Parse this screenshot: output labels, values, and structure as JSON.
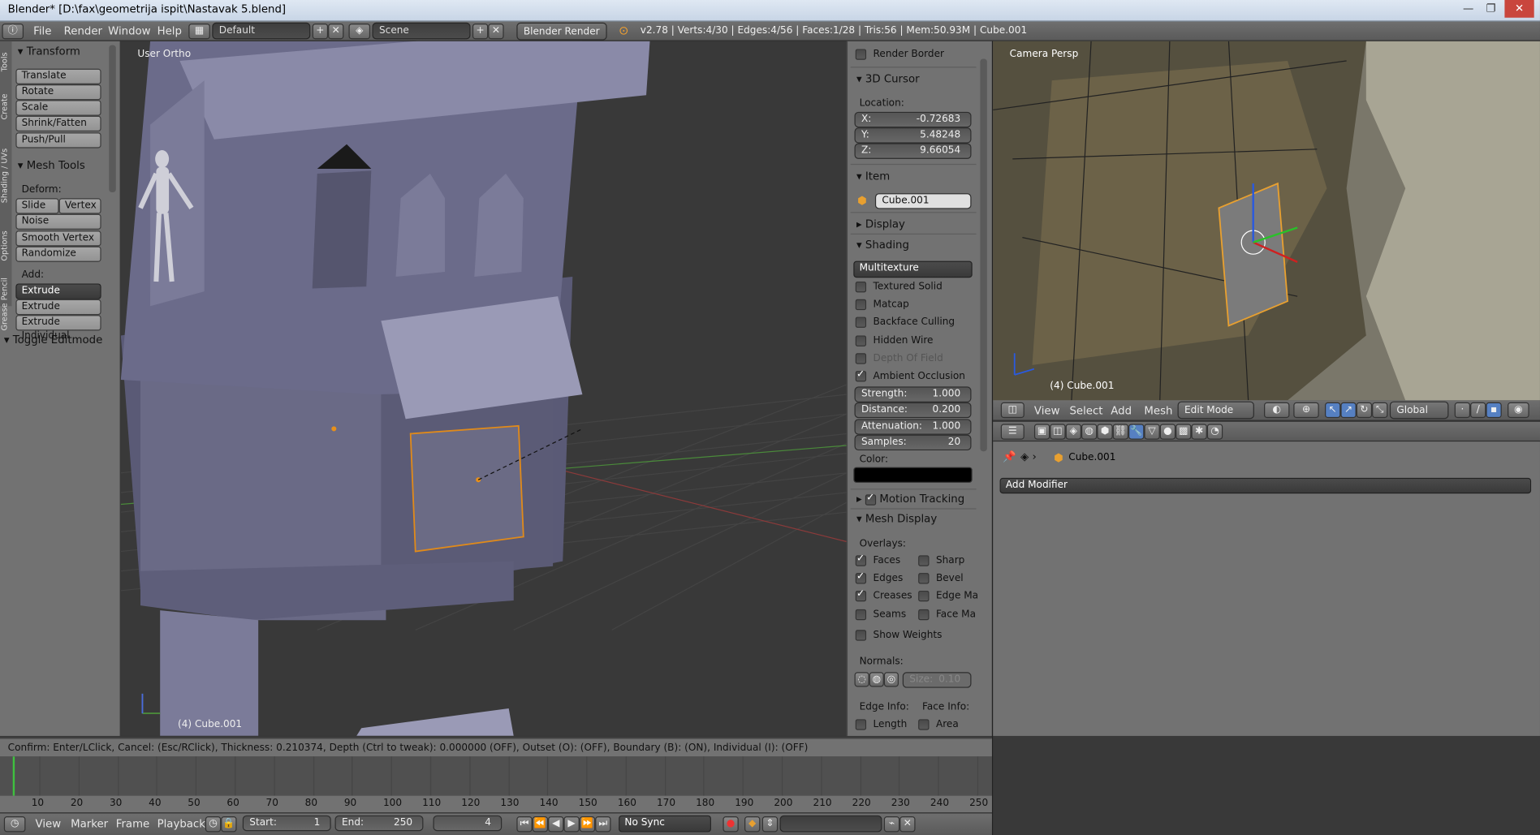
{
  "window": {
    "title": "Blender* [D:\\fax\\geometrija ispit\\Nastavak 5.blend]",
    "min": "—",
    "max": "❐",
    "close": "✕"
  },
  "topbar": {
    "menus": [
      "File",
      "Render",
      "Window",
      "Help"
    ],
    "layout": "Default",
    "scene": "Scene",
    "engine": "Blender Render",
    "stats": "v2.78 | Verts:4/30 | Edges:4/56 | Faces:1/28 | Tris:56 | Mem:50.93M | Cube.001"
  },
  "toolshelf": {
    "tabs": [
      "Tools",
      "Create",
      "Shading / UVs",
      "Options",
      "Grease Pencil"
    ],
    "transform": {
      "title": "Transform",
      "buttons": [
        "Translate",
        "Rotate",
        "Scale",
        "Shrink/Fatten",
        "Push/Pull"
      ]
    },
    "mesh_tools": {
      "title": "Mesh Tools",
      "deform_label": "Deform:",
      "slide_edge": "Slide Ed",
      "vertex": "Vertex",
      "buttons": [
        "Noise",
        "Smooth Vertex",
        "Randomize"
      ],
      "add_label": "Add:",
      "extrude": "Extrude",
      "add_buttons": [
        "Extrude Region",
        "Extrude Individual"
      ]
    },
    "toggle": "Toggle Editmode"
  },
  "viewport_left": {
    "label": "User Ortho",
    "object": "(4) Cube.001"
  },
  "properties": {
    "render_border": "Render Border",
    "cursor": {
      "title": "3D Cursor",
      "location_label": "Location:",
      "x_label": "X:",
      "x": "-0.72683",
      "y_label": "Y:",
      "y": "5.48248",
      "z_label": "Z:",
      "z": "9.66054"
    },
    "item": {
      "title": "Item",
      "name": "Cube.001"
    },
    "display": "Display",
    "shading": {
      "title": "Shading",
      "mode": "Multitexture",
      "options": [
        {
          "label": "Textured Solid",
          "checked": false
        },
        {
          "label": "Matcap",
          "checked": false
        },
        {
          "label": "Backface Culling",
          "checked": false
        },
        {
          "label": "Hidden Wire",
          "checked": false
        },
        {
          "label": "Depth Of Field",
          "checked": false
        },
        {
          "label": "Ambient Occlusion",
          "checked": true
        }
      ],
      "fields": [
        {
          "label": "Strength:",
          "value": "1.000"
        },
        {
          "label": "Distance:",
          "value": "0.200"
        },
        {
          "label": "Attenuation:",
          "value": "1.000"
        },
        {
          "label": "Samples:",
          "value": "20"
        }
      ],
      "color_label": "Color:",
      "color": "#000000"
    },
    "motion_tracking": "Motion Tracking",
    "mesh_display": {
      "title": "Mesh Display",
      "overlays_label": "Overlays:",
      "left": [
        {
          "label": "Faces",
          "checked": true
        },
        {
          "label": "Edges",
          "checked": true
        },
        {
          "label": "Creases",
          "checked": true
        },
        {
          "label": "Seams",
          "checked": false
        }
      ],
      "right": [
        {
          "label": "Sharp",
          "checked": false
        },
        {
          "label": "Bevel",
          "checked": false
        },
        {
          "label": "Edge Ma",
          "checked": false
        },
        {
          "label": "Face Ma",
          "checked": false
        }
      ],
      "show_weights": "Show Weights",
      "normals_label": "Normals:",
      "size_label": "Size:",
      "size": "0.10",
      "edge_info": "Edge Info:",
      "face_info": "Face Info:",
      "length": "Length",
      "area": "Area"
    }
  },
  "viewport_right": {
    "label": "Camera Persp",
    "object": "(4) Cube.001",
    "menus": [
      "View",
      "Select",
      "Add",
      "Mesh"
    ],
    "mode": "Edit Mode",
    "orientation": "Global"
  },
  "modifiers": {
    "object": "Cube.001",
    "add_modifier": "Add Modifier"
  },
  "status": "Confirm: Enter/LClick, Cancel: (Esc/RClick), Thickness: 0.210374, Depth (Ctrl to tweak): 0.000000 (OFF), Outset (O): (OFF), Boundary (B): (ON), Individual (I): (OFF)",
  "timeline": {
    "ticks": [
      "10",
      "20",
      "30",
      "40",
      "50",
      "60",
      "70",
      "80",
      "90",
      "100",
      "110",
      "120",
      "130",
      "140",
      "150",
      "160",
      "170",
      "180",
      "190",
      "200",
      "210",
      "220",
      "230",
      "240",
      "250"
    ],
    "menus": [
      "View",
      "Marker",
      "Frame",
      "Playback"
    ],
    "start_label": "Start:",
    "start": "1",
    "end_label": "End:",
    "end": "250",
    "current": "4",
    "sync": "No Sync"
  }
}
